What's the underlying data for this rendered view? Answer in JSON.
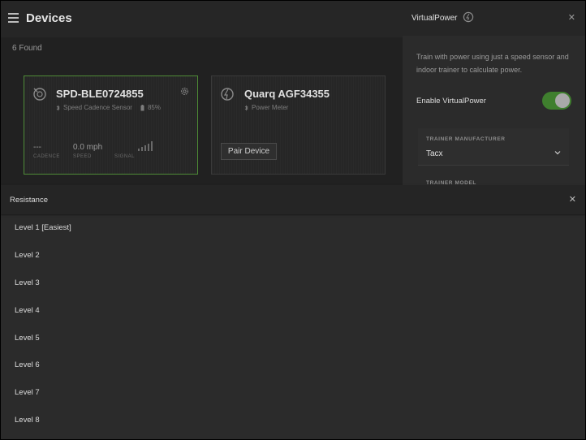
{
  "header": {
    "title": "Devices",
    "found_label": "6 Found"
  },
  "devices": [
    {
      "name": "SPD-BLE0724855",
      "type": "Speed Cadence Sensor",
      "battery": "85%",
      "metrics": [
        {
          "value": "---",
          "label": "CADENCE"
        },
        {
          "value": "0.0 mph",
          "label": "SPEED"
        },
        {
          "value": "",
          "label": "SIGNAL"
        }
      ],
      "status": "connected"
    },
    {
      "name": "Quarq AGF34355",
      "type": "Power Meter",
      "action_label": "Pair Device",
      "status": "unpaired"
    }
  ],
  "virtual_power": {
    "title": "VirtualPower",
    "description": "Train with power using just a speed sensor and indoor trainer to calculate power.",
    "enable_label": "Enable VirtualPower",
    "enabled": true,
    "manufacturer_label": "TRAINER MANUFACTURER",
    "manufacturer_value": "Tacx",
    "model_label": "TRAINER MODEL"
  },
  "resistance": {
    "title": "Resistance",
    "levels": [
      "Level 1 [Easiest]",
      "Level 2",
      "Level 3",
      "Level 4",
      "Level 5",
      "Level 6",
      "Level 7",
      "Level 8"
    ]
  },
  "colors": {
    "accent": "#3f7f2e",
    "active_border": "#4e8a36",
    "background": "#222222"
  },
  "icons": {
    "menu": "hamburger-menu-icon",
    "close": "close-icon",
    "gear": "gear-icon",
    "sensor": "speed-sensor-icon",
    "power": "power-meter-icon",
    "bluetooth": "bluetooth-icon",
    "battery": "battery-icon",
    "signal": "signal-bars-icon",
    "chevron": "chevron-down-icon"
  }
}
